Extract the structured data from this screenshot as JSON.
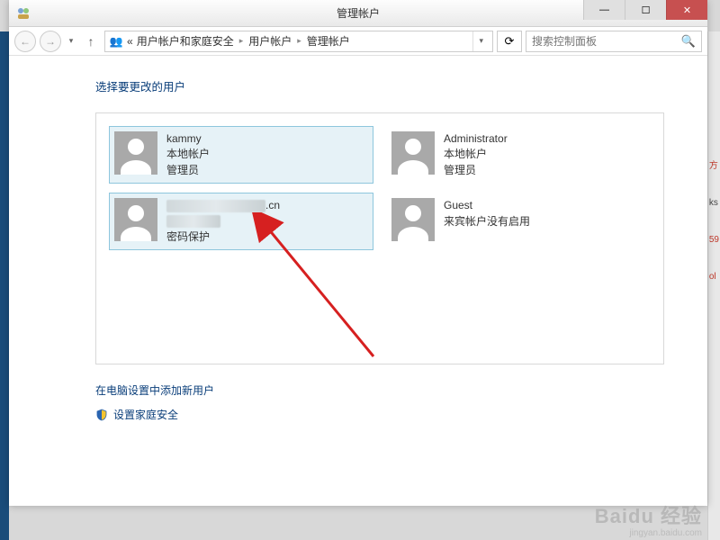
{
  "titlebar": {
    "title": "管理帐户"
  },
  "window_controls": {
    "min": "—",
    "max": "☐",
    "close": "✕"
  },
  "nav": {
    "back": "←",
    "forward": "→",
    "dropdown": "▾",
    "up": "↑",
    "refresh": "⟳"
  },
  "address": {
    "root_icon": "👥",
    "prefix": "«",
    "items": [
      "用户帐户和家庭安全",
      "用户帐户",
      "管理帐户"
    ],
    "sep": "▸",
    "dd": "▾"
  },
  "search": {
    "placeholder": "搜索控制面板",
    "icon": "🔍"
  },
  "page": {
    "heading": "选择要更改的用户",
    "add_user_link": "在电脑设置中添加新用户",
    "family_safety_link": "设置家庭安全"
  },
  "users": [
    {
      "name": "kammy",
      "line1": "本地帐户",
      "line2": "管理员",
      "selected": true,
      "blurred": false
    },
    {
      "name": "Administrator",
      "line1": "本地帐户",
      "line2": "管理员",
      "selected": false,
      "blurred": false
    },
    {
      "name": ".cn",
      "line1": "密码保护",
      "line2": "",
      "selected": true,
      "blurred": true
    },
    {
      "name": "Guest",
      "line1": "来宾帐户没有启用",
      "line2": "",
      "selected": false,
      "blurred": false
    }
  ],
  "watermark": {
    "main": "Baidu 经验",
    "sub": "jingyan.baidu.com"
  }
}
